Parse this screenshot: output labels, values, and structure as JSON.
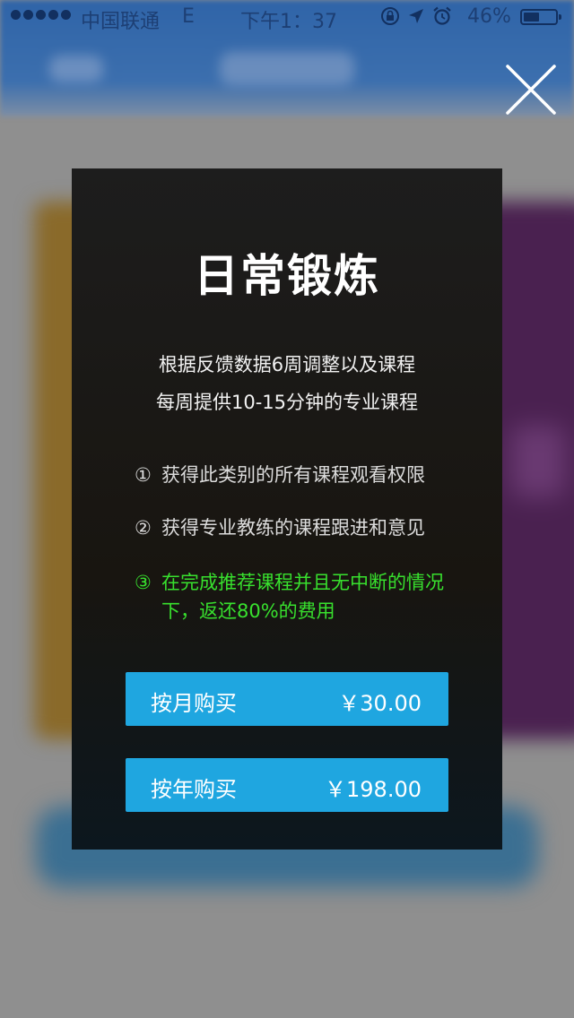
{
  "status_bar": {
    "carrier": "中国联通",
    "network": "E",
    "time": "下午1：37",
    "battery": "46%",
    "battery_level": 0.46
  },
  "modal": {
    "title": "日常锻炼",
    "description": [
      "根据反馈数据6周调整以及课程",
      "每周提供10-15分钟的专业课程"
    ],
    "features": [
      {
        "num": "①",
        "text": "获得此类别的所有课程观看权限"
      },
      {
        "num": "②",
        "text": "获得专业教练的课程跟进和意见"
      },
      {
        "num": "③",
        "text": "在完成推荐课程并且无中断的情况下，返还80%的费用"
      }
    ],
    "monthly": {
      "label": "按月购买",
      "price": "￥30.00"
    },
    "yearly": {
      "label": "按年购买",
      "price": "￥198.00"
    }
  },
  "colors": {
    "accent": "#1fa6e0",
    "highlight": "#38e12e"
  },
  "icons": [
    "signal-dots-icon",
    "rotation-lock-icon",
    "location-arrow-icon",
    "alarm-icon",
    "battery-icon",
    "close-icon"
  ]
}
